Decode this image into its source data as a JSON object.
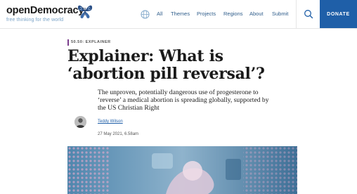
{
  "site": {
    "logo_open": "open",
    "logo_democracy": "Democracy",
    "tagline": "free thinking for the world"
  },
  "nav": {
    "items": [
      {
        "label": "All"
      },
      {
        "label": "Themes"
      },
      {
        "label": "Projects"
      },
      {
        "label": "Regions"
      },
      {
        "label": "About"
      },
      {
        "label": "Submit"
      }
    ],
    "donate_label": "DONATE"
  },
  "article": {
    "kicker": "50.50: EXPLAINER",
    "title": "Explainer: What is ‘abortion pill reversal’?",
    "standfirst": "The unproven, potentially dangerous use of progesterone to ‘reverse’ a medical abortion is spreading globally, supported by the US Christian Right",
    "author": "Teddy Wilson",
    "date": "27 May 2021, 6.58am"
  },
  "colors": {
    "accent": "#1f5fa8",
    "kicker_bar": "#7a3d8c",
    "nav_text": "#2e5c8a"
  },
  "icons": {
    "logo": "butterfly-icon",
    "language": "globe-icon",
    "search": "search-icon"
  }
}
